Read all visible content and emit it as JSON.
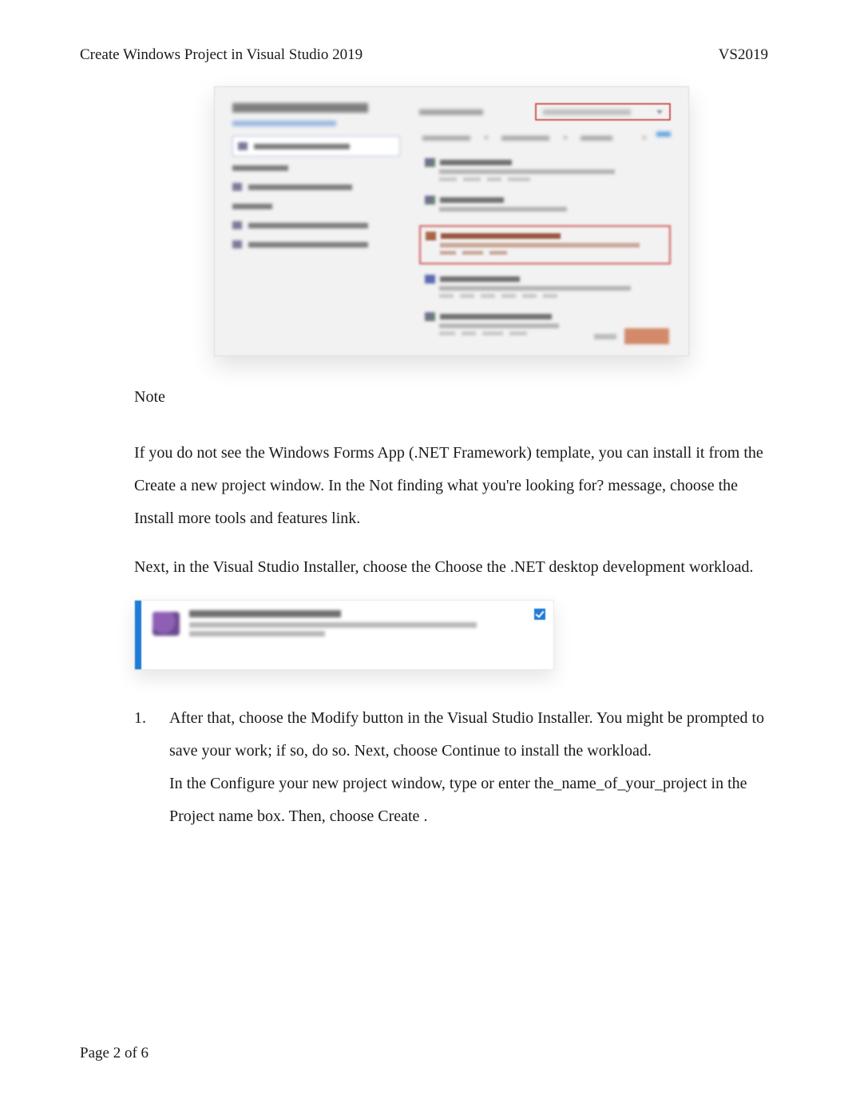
{
  "header": {
    "title_left": "Create Windows Project in Visual Studio 2019",
    "title_right": "VS2019"
  },
  "note": {
    "heading": "Note",
    "paragraph1_parts": {
      "a": "If you do not see the ",
      "b": "Windows Forms App (.NET Framework)",
      "c": " template, you can install it from the ",
      "d": "Create a new project",
      "e": " window. In the ",
      "f": "Not finding what you're looking for?",
      "g": " message, choose the ",
      "h": "Install more tools and features",
      "i": " link."
    },
    "paragraph2_parts": {
      "a": "Next, in the Visual Studio Installer, choose the Choose the ",
      "b": ".NET desktop development",
      "c": " workload."
    }
  },
  "list": {
    "item1": {
      "number": "1.",
      "parts": {
        "a": "After that, choose the ",
        "b": "Modify",
        "c": " button in the Visual Studio Installer. You might be prompted to save your work; if so, do so. Next, choose ",
        "d": "Continue",
        "e": " to install the workload."
      },
      "parts2": {
        "a": "In the ",
        "b": "Configure your new project",
        "c": " window, type or enter ",
        "d": "the_name_of_your_project",
        "e": " in the ",
        "f": "Project name",
        "g": " box. Then, choose ",
        "h": "Create",
        "i": " ."
      }
    }
  },
  "footer": {
    "page_label_a": "Page ",
    "page_current": "2",
    "page_label_b": " of 6"
  }
}
